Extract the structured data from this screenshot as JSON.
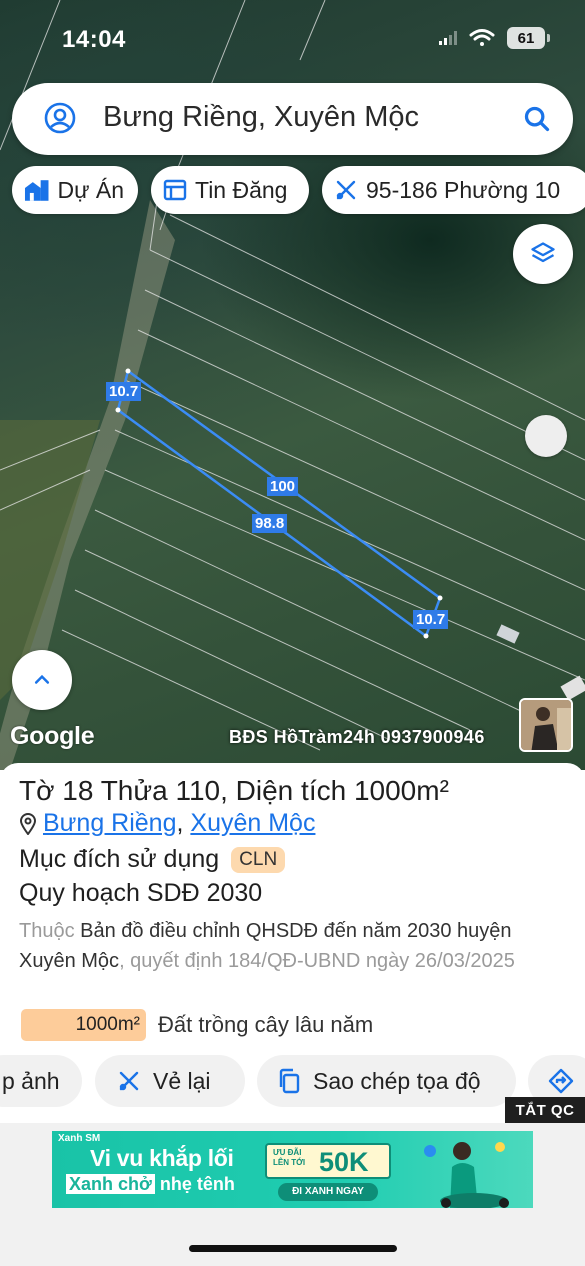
{
  "status_bar": {
    "time": "14:04",
    "battery": "61"
  },
  "search": {
    "query": "Bưng Riềng, Xuyên Mộc"
  },
  "chips": [
    {
      "label": "Dự Án",
      "icon": "building-icon"
    },
    {
      "label": "Tin Đăng",
      "icon": "listing-icon"
    },
    {
      "label": "95-186 Phường 10",
      "icon": "tools-icon"
    }
  ],
  "map": {
    "dimensions": {
      "top_left": "10.7",
      "top": "100",
      "bottom": "98.8",
      "bottom_right": "10.7"
    },
    "google_logo": "Google",
    "watermark": "BĐS HồTràm24h 0937900946",
    "outline_color": "#3b8cf5"
  },
  "parcel": {
    "title_prefix": "Tờ",
    "sheet_no": "18",
    "title_mid": "Thửa",
    "parcel_no": "110",
    "area_label": ", Diện tích",
    "area": "1000m²",
    "location_link_1": "Bưng Riềng",
    "location_sep": ",",
    "location_link_2": "Xuyên Mộc",
    "purpose_label": "Mục đích sử dụng",
    "purpose_code": "CLN",
    "plan_title": "Quy hoạch SDĐ 2030",
    "desc_prefix": "Thuộc",
    "desc_main": "Bản đồ điều chỉnh QHSDĐ đến năm 2030 huyện Xuyên Mộc",
    "desc_suffix": ", quyết định 184/QĐ-UBND ngày 26/03/2025",
    "legend_value": "1000m²",
    "legend_label": "Đất trồng cây lâu năm",
    "legend_color": "#fdcc9a"
  },
  "actions": [
    {
      "label": "p ảnh"
    },
    {
      "label": "Vẻ lại"
    },
    {
      "label": "Sao chép tọa độ"
    },
    {
      "label": ""
    }
  ],
  "ad": {
    "close_label": "TẮT QC",
    "brand": "Xanh SM",
    "line1": "Vi vu khắp lối",
    "line2_highlight": "Xanh chở",
    "line2_rest": "nhẹ tênh",
    "promo_small": "ƯU ĐÃI LÊN TỚI",
    "promo_big": "50K",
    "cta": "ĐI XANH NGAY"
  }
}
